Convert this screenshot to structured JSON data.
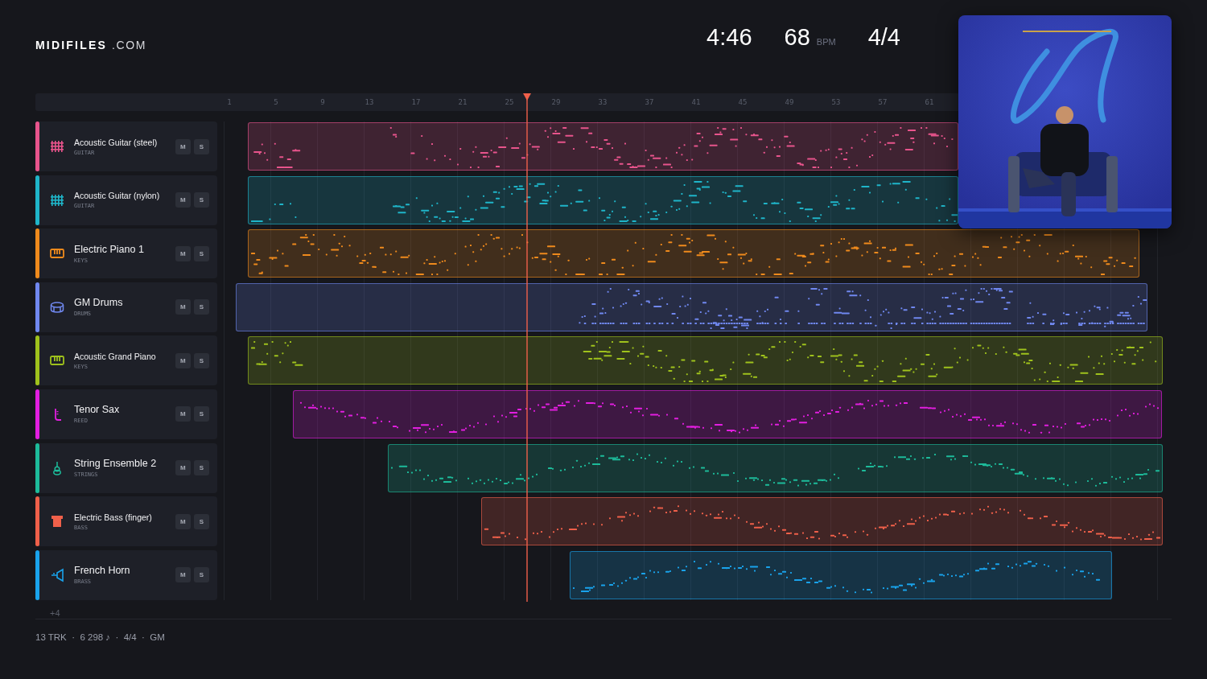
{
  "logo": {
    "name": "MIDIFILES",
    "suffix": ".COM"
  },
  "stats": {
    "duration": "4:46",
    "tempo": "68",
    "tempo_unit": "BPM",
    "meter": "4/4"
  },
  "ruler": [
    "1",
    "5",
    "9",
    "13",
    "17",
    "21",
    "25",
    "29",
    "33",
    "37",
    "41",
    "45",
    "49",
    "53",
    "57",
    "61"
  ],
  "tracks": [
    {
      "name": "Acoustic Guitar (steel)",
      "category": "GUITAR",
      "kind": "guitar",
      "color": "#e8548c",
      "mute_label": "M",
      "solo_label": "S"
    },
    {
      "name": "Acoustic Guitar (nylon)",
      "category": "GUITAR",
      "kind": "guitar",
      "color": "#1fb5c9",
      "mute_label": "M",
      "solo_label": "S"
    },
    {
      "name": "Electric Piano 1",
      "category": "KEYS",
      "kind": "keys",
      "color": "#ef8a1c",
      "mute_label": "M",
      "solo_label": "S"
    },
    {
      "name": "GM Drums",
      "category": "DRUMS",
      "kind": "drums",
      "color": "#7088f0",
      "mute_label": "M",
      "solo_label": "S"
    },
    {
      "name": "Acoustic Grand Piano",
      "category": "KEYS",
      "kind": "keys",
      "color": "#9fc21c",
      "mute_label": "M",
      "solo_label": "S"
    },
    {
      "name": "Tenor Sax",
      "category": "REED",
      "kind": "reed",
      "color": "#e21ee0",
      "mute_label": "M",
      "solo_label": "S"
    },
    {
      "name": "String Ensemble 2",
      "category": "STRINGS",
      "kind": "strings",
      "color": "#1dbb9a",
      "mute_label": "M",
      "solo_label": "S"
    },
    {
      "name": "Electric Bass (finger)",
      "category": "BASS",
      "kind": "bass",
      "color": "#f0604a",
      "mute_label": "M",
      "solo_label": "S"
    },
    {
      "name": "French Horn",
      "category": "BRASS",
      "kind": "brass",
      "color": "#19a3ec",
      "mute_label": "M",
      "solo_label": "S"
    }
  ],
  "hidden_tracks": "+4",
  "footer": "13 TRK  ·  6 298 ♪  ·  4/4  ·  GM"
}
